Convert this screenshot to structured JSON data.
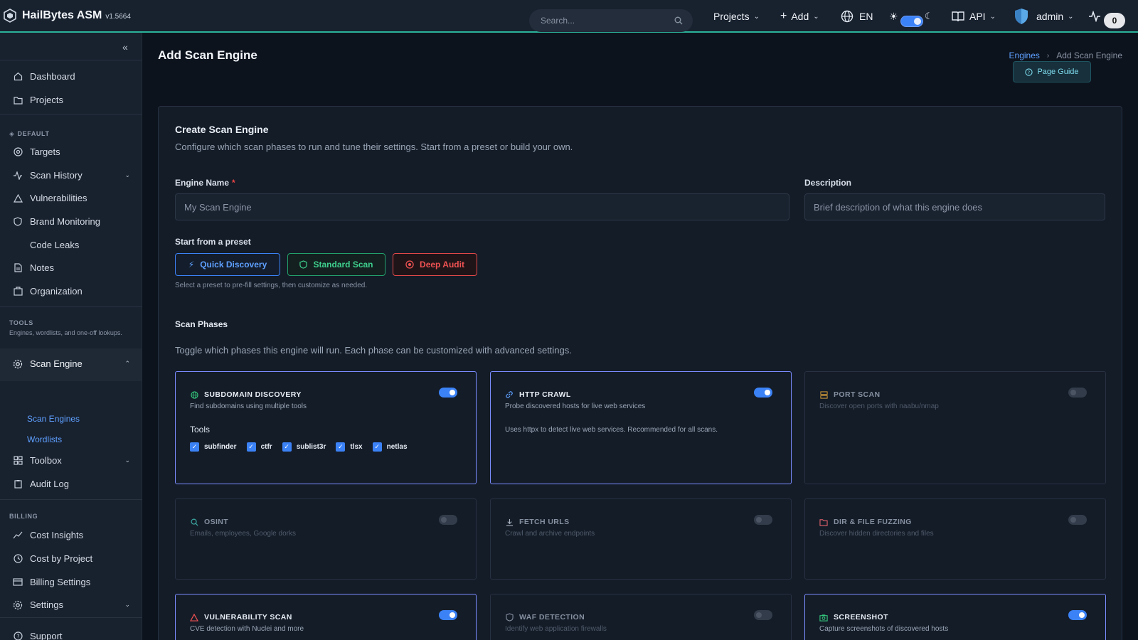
{
  "app": {
    "name": "HailBytes ASM",
    "version": "v1.5664",
    "accent": "#2bb39a"
  },
  "topbar": {
    "search_placeholder": "Search...",
    "projects_label": "Projects",
    "add_label": "Add",
    "lang_label": "EN",
    "api_label": "API",
    "user_label": "admin",
    "activity_count": "0"
  },
  "sidebar": {
    "items_top": [
      {
        "label": "Dashboard",
        "icon": "home-icon"
      },
      {
        "label": "Projects",
        "icon": "folder-icon"
      }
    ],
    "section_default": "DEFAULT",
    "items_default": [
      {
        "label": "Targets",
        "icon": "target-icon"
      },
      {
        "label": "Scan History",
        "icon": "activity-icon"
      },
      {
        "label": "Vulnerabilities",
        "icon": "warning-icon"
      },
      {
        "label": "Brand Monitoring",
        "icon": "shield-icon"
      },
      {
        "label": "Code Leaks",
        "icon": ""
      },
      {
        "label": "Notes",
        "icon": "note-icon"
      },
      {
        "label": "Organization",
        "icon": "building-icon"
      }
    ],
    "section_tools": "TOOLS",
    "section_tools_sub": "Engines, wordlists, and one-off lookups.",
    "scan_engine_label": "Scan Engine",
    "sub_links": [
      "Scan Engines",
      "Wordlists"
    ],
    "toolbox_label": "Toolbox",
    "audit_label": "Audit Log",
    "section_billing": "BILLING",
    "items_billing": [
      {
        "label": "Cost Insights",
        "icon": "trend-icon"
      },
      {
        "label": "Cost by Project",
        "icon": "clock-icon"
      },
      {
        "label": "Billing Settings",
        "icon": "card-icon"
      },
      {
        "label": "Settings",
        "icon": "gear-icon"
      }
    ],
    "support_label": "Support"
  },
  "page": {
    "title": "Add Scan Engine",
    "breadcrumb_link": "Engines",
    "breadcrumb_current": "Add Scan Engine",
    "guide_label": "Page Guide"
  },
  "form": {
    "title": "Create Scan Engine",
    "description": "Configure which scan phases to run and tune their settings. Start from a preset or build your own.",
    "name_label": "Engine Name",
    "name_required": "*",
    "name_placeholder": "My Scan Engine",
    "desc_label": "Description",
    "desc_placeholder": "Brief description of what this engine does",
    "preset_label": "Start from a preset",
    "presets": [
      "Quick Discovery",
      "Standard Scan",
      "Deep Audit"
    ],
    "preset_hint": "Select a preset to pre-fill settings, then customize as needed.",
    "phases_title": "Scan Phases",
    "phases_desc": "Toggle which phases this engine will run. Each phase can be customized with advanced settings."
  },
  "phases": [
    {
      "title": "SUBDOMAIN DISCOVERY",
      "desc": "Find subdomains using multiple tools",
      "enabled": true,
      "tools_label": "Tools",
      "tools": [
        "subfinder",
        "ctfr",
        "sublist3r",
        "tlsx",
        "netlas"
      ]
    },
    {
      "title": "HTTP CRAWL",
      "desc": "Probe discovered hosts for live web services",
      "enabled": true,
      "note": "Uses httpx to detect live web services. Recommended for all scans."
    },
    {
      "title": "PORT SCAN",
      "desc": "Discover open ports with naabu/nmap",
      "enabled": false
    },
    {
      "title": "OSINT",
      "desc": "Emails, employees, Google dorks",
      "enabled": false
    },
    {
      "title": "FETCH URLS",
      "desc": "Crawl and archive endpoints",
      "enabled": false
    },
    {
      "title": "DIR & FILE FUZZING",
      "desc": "Discover hidden directories and files",
      "enabled": false
    },
    {
      "title": "VULNERABILITY SCAN",
      "desc": "CVE detection with Nuclei and more",
      "enabled": true
    },
    {
      "title": "WAF DETECTION",
      "desc": "Identify web application firewalls",
      "enabled": false
    },
    {
      "title": "SCREENSHOT",
      "desc": "Capture screenshots of discovered hosts",
      "enabled": true
    }
  ]
}
